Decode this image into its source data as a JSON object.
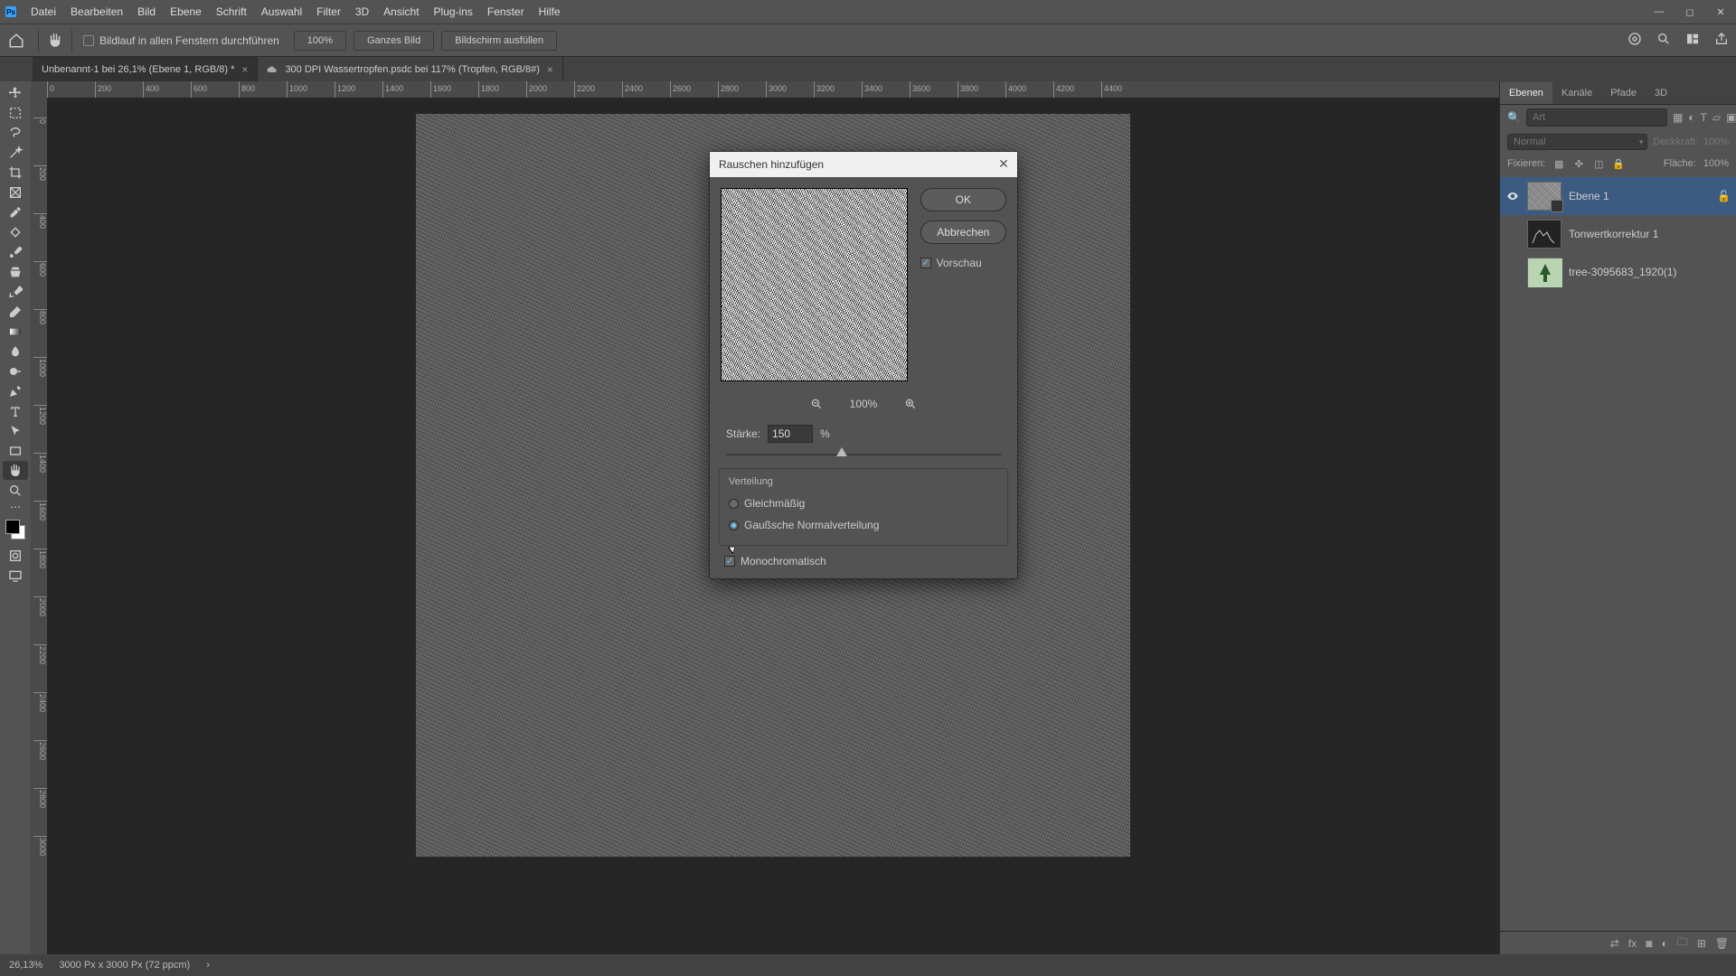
{
  "menubar": {
    "items": [
      "Datei",
      "Bearbeiten",
      "Bild",
      "Ebene",
      "Schrift",
      "Auswahl",
      "Filter",
      "3D",
      "Ansicht",
      "Plug-ins",
      "Fenster",
      "Hilfe"
    ]
  },
  "optionsbar": {
    "scroll_all": "Bildlauf in allen Fenstern durchführen",
    "zoom100": "100%",
    "fit_all": "Ganzes Bild",
    "fill_screen": "Bildschirm ausfüllen"
  },
  "doctabs": {
    "tab1": "Unbenannt-1 bei 26,1% (Ebene 1, RGB/8) *",
    "tab2": "300 DPI Wassertropfen.psdc bei 117% (Tropfen, RGB/8#)"
  },
  "hruler_ticks": [
    "0",
    "200",
    "400",
    "600",
    "800",
    "1000",
    "1200",
    "1400",
    "1600",
    "1800",
    "2000",
    "2200",
    "2400",
    "2600",
    "2800",
    "3000",
    "3200",
    "3400",
    "3600",
    "3800",
    "4000",
    "4200",
    "4400"
  ],
  "vruler_ticks": [
    "0",
    "200",
    "400",
    "600",
    "800",
    "1000",
    "1200",
    "1400",
    "1600",
    "1800",
    "2000",
    "2200",
    "2400",
    "2600",
    "2800",
    "3000"
  ],
  "panels": {
    "tabs": [
      "Ebenen",
      "Kanäle",
      "Pfade",
      "3D"
    ],
    "search_placeholder": "Art",
    "blend_mode": "Normal",
    "opacity_label": "Deckkraft:",
    "opacity_value": "100%",
    "lock_label": "Fixieren:",
    "fill_label": "Fläche:",
    "fill_value": "100%",
    "layers": [
      {
        "name": "Ebene 1",
        "selected": true,
        "visible": true,
        "kind": "noise"
      },
      {
        "name": "Tonwertkorrektur 1",
        "selected": false,
        "visible": false,
        "kind": "levels"
      },
      {
        "name": "tree-3095683_1920(1)",
        "selected": false,
        "visible": false,
        "kind": "tree"
      }
    ]
  },
  "dialog": {
    "title": "Rauschen hinzufügen",
    "ok": "OK",
    "cancel": "Abbrechen",
    "preview": "Vorschau",
    "zoom": "100%",
    "amount_label": "Stärke:",
    "amount_value": "150",
    "amount_unit": "%",
    "dist_label": "Verteilung",
    "uniform": "Gleichmäßig",
    "gaussian": "Gaußsche Normalverteilung",
    "mono": "Monochromatisch",
    "slider_pct": 40
  },
  "status": {
    "zoom": "26,13%",
    "docinfo": "3000 Px x 3000 Px (72 ppcm)"
  }
}
